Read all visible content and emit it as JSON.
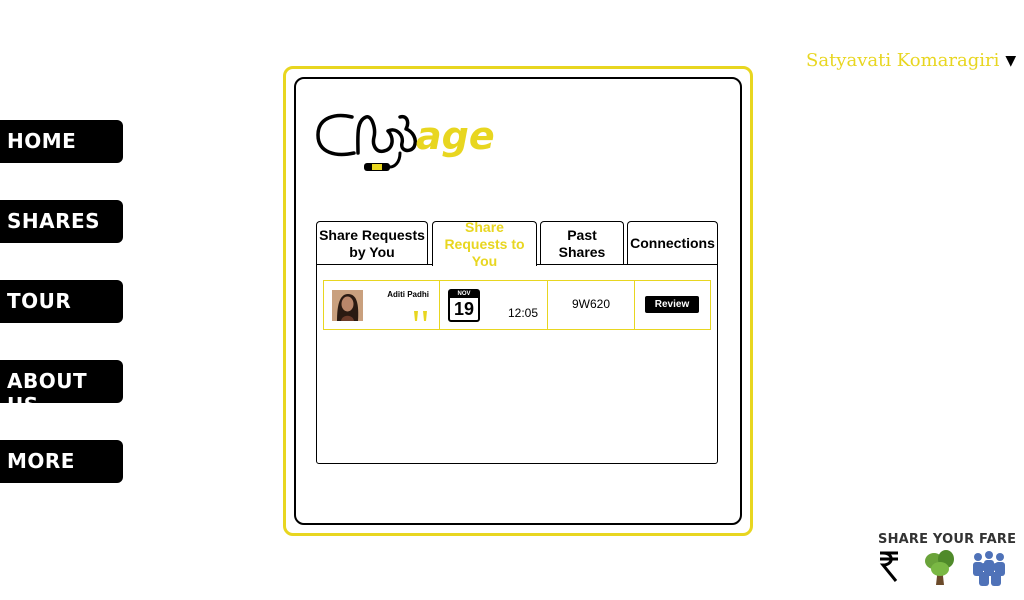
{
  "nav": {
    "items": [
      {
        "label": "HOME"
      },
      {
        "label": "SHARES"
      },
      {
        "label": "TOUR"
      },
      {
        "label": "ABOUT US"
      },
      {
        "label": "MORE"
      }
    ]
  },
  "user": {
    "name": "Satyavati Komaragiri",
    "caret": "▼"
  },
  "logo": {
    "text": "age"
  },
  "tabs": [
    {
      "label": "Share Requests by You",
      "active": false
    },
    {
      "label": "Share Requests to You",
      "active": true
    },
    {
      "label": "Past Shares",
      "active": false
    },
    {
      "label": "Connections",
      "active": false
    }
  ],
  "requests": [
    {
      "name": "Aditi Padhi",
      "date_month": "NOV",
      "date_day": "19",
      "time": "12:05",
      "flight": "9W620",
      "action": "Review"
    }
  ],
  "brand": {
    "title": "SHARE YOUR FARE"
  },
  "colors": {
    "accent": "#e8d620",
    "dark": "#000000",
    "blue": "#4f72b8",
    "green": "#6aa33a"
  }
}
